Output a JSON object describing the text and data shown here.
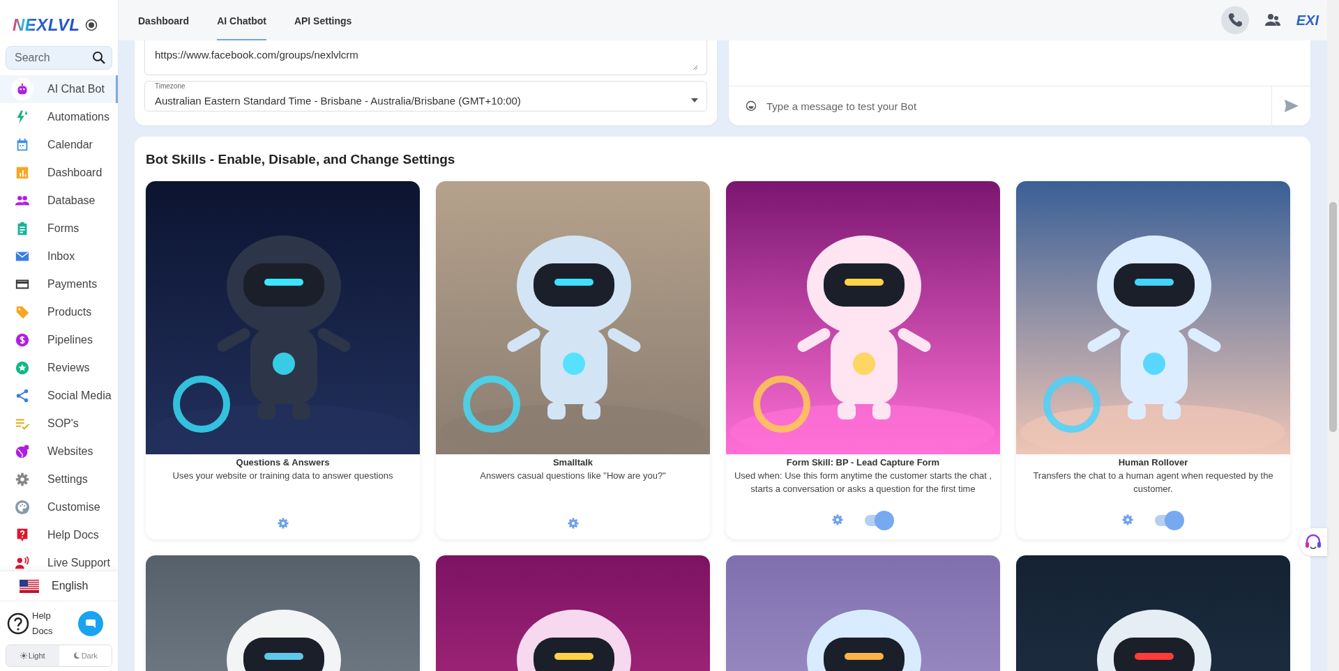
{
  "sidebar": {
    "logo": "NEXLVL",
    "search": {
      "placeholder": "Search"
    },
    "items": [
      {
        "label": "AI Chat Bot",
        "selected": true
      },
      {
        "label": "Automations",
        "selected": false
      },
      {
        "label": "Calendar",
        "selected": false
      },
      {
        "label": "Dashboard",
        "selected": false
      },
      {
        "label": "Database",
        "selected": false
      },
      {
        "label": "Forms",
        "selected": false
      },
      {
        "label": "Inbox",
        "selected": false
      },
      {
        "label": "Payments",
        "selected": false
      },
      {
        "label": "Products",
        "selected": false
      },
      {
        "label": "Pipelines",
        "selected": false
      },
      {
        "label": "Reviews",
        "selected": false
      },
      {
        "label": "Social Media",
        "selected": false
      },
      {
        "label": "SOP's",
        "selected": false
      },
      {
        "label": "Websites",
        "selected": false
      },
      {
        "label": "Settings",
        "selected": false
      },
      {
        "label": "Customise",
        "selected": false
      },
      {
        "label": "Help Docs",
        "selected": false
      },
      {
        "label": "Live Support",
        "selected": false
      }
    ],
    "language": "English",
    "help_label": "Help Docs",
    "theme": [
      {
        "label": "Light",
        "selected": true
      },
      {
        "label": "Dark",
        "selected": false
      }
    ]
  },
  "header": {
    "tabs": [
      {
        "label": "Dashboard",
        "selected": false
      },
      {
        "label": "AI Chatbot",
        "selected": true
      },
      {
        "label": "API Settings",
        "selected": false
      }
    ],
    "logo_text": "EXI"
  },
  "settings_form": {
    "link_value": "https://www.facebook.com/groups/nexlvlcrm",
    "timezone": {
      "label": "Timezone",
      "value": "Australian Eastern Standard Time - Brisbane - Australia/Brisbane (GMT+10:00)"
    }
  },
  "chat_test": {
    "placeholder": "Type a message to test your Bot"
  },
  "skills": {
    "title": "Bot Skills - Enable, Disable, and Change Settings",
    "cards": [
      {
        "title": "Questions & Answers",
        "description": "Uses your website or training data to answer questions"
      },
      {
        "title": "Smalltalk",
        "description": "Answers casual questions like \"How are you?\""
      },
      {
        "title": "Form Skill: BP - Lead Capture Form",
        "description": "Used when: Use this form anytime the customer starts the chat , starts a conversation or asks a question for the first time",
        "toggle": {
          "on": true
        }
      },
      {
        "title": "Human Rollover",
        "description": "Transfers the chat to a human agent when requested by the customer.",
        "toggle": {
          "on": true
        }
      }
    ]
  }
}
